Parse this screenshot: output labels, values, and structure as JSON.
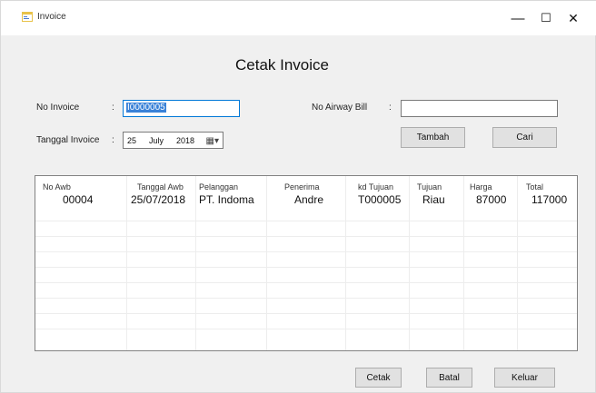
{
  "window": {
    "title": "Invoice",
    "controls": {
      "minimize": "—",
      "maximize": "☐",
      "close": "✕"
    }
  },
  "heading": "Cetak Invoice",
  "form": {
    "no_invoice": {
      "label": "No Invoice",
      "value": "I0000005"
    },
    "tanggal_invoice": {
      "label": "Tanggal Invoice",
      "day": "25",
      "month": "July",
      "year": "2018"
    },
    "no_airway": {
      "label": "No Airway Bill",
      "value": ""
    },
    "colon": ":"
  },
  "buttons": {
    "tambah": "Tambah",
    "cari": "Cari",
    "cetak": "Cetak",
    "batal": "Batal",
    "keluar": "Keluar"
  },
  "table": {
    "columns": [
      "No Awb",
      "Tanggal Awb",
      "Pelanggan",
      "Penerima",
      "kd Tujuan",
      "Tujuan",
      "Harga",
      "Total"
    ],
    "rows": [
      [
        "00004",
        "25/07/2018",
        "PT. Indoma",
        "Andre",
        "T000005",
        "Riau",
        "87000",
        "117000"
      ]
    ]
  },
  "icons": {
    "app": "form-icon",
    "calendar": "calendar-dropdown-icon"
  }
}
